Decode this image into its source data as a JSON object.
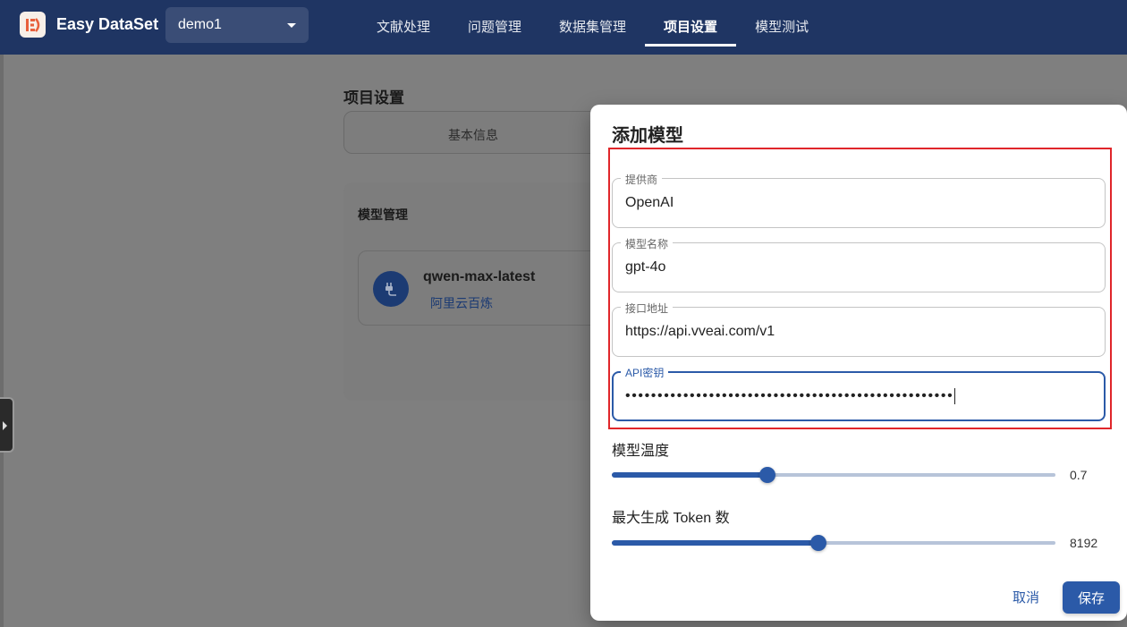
{
  "app": {
    "brand": "Easy DataSet",
    "project_selector": "demo1"
  },
  "nav": {
    "tabs": [
      {
        "label": "文献处理"
      },
      {
        "label": "问题管理"
      },
      {
        "label": "数据集管理"
      },
      {
        "label": "项目设置",
        "active": true
      },
      {
        "label": "模型测试"
      }
    ]
  },
  "background": {
    "page_title": "项目设置",
    "basic_tab": "基本信息",
    "model_management_title": "模型管理",
    "model_item": {
      "name": "qwen-max-latest",
      "provider": "阿里云百炼"
    }
  },
  "dialog": {
    "title": "添加模型",
    "fields": {
      "provider": {
        "label": "提供商",
        "value": "OpenAI"
      },
      "model_name": {
        "label": "模型名称",
        "value": "gpt-4o"
      },
      "endpoint": {
        "label": "接口地址",
        "value": "https://api.vveai.com/v1"
      },
      "api_key": {
        "label": "API密钥",
        "value": "•••••••••••••••••••••••••••••••••••••••••••••••••••"
      }
    },
    "temperature": {
      "label": "模型温度",
      "value": "0.7",
      "fraction": 0.35
    },
    "max_tokens": {
      "label": "最大生成 Token 数",
      "value": "8192",
      "fraction": 0.465
    },
    "cancel_label": "取消",
    "save_label": "保存"
  },
  "colors": {
    "nav_bg": "#1f3563",
    "accent": "#2b5aa8",
    "highlight_border": "#e0262a"
  }
}
